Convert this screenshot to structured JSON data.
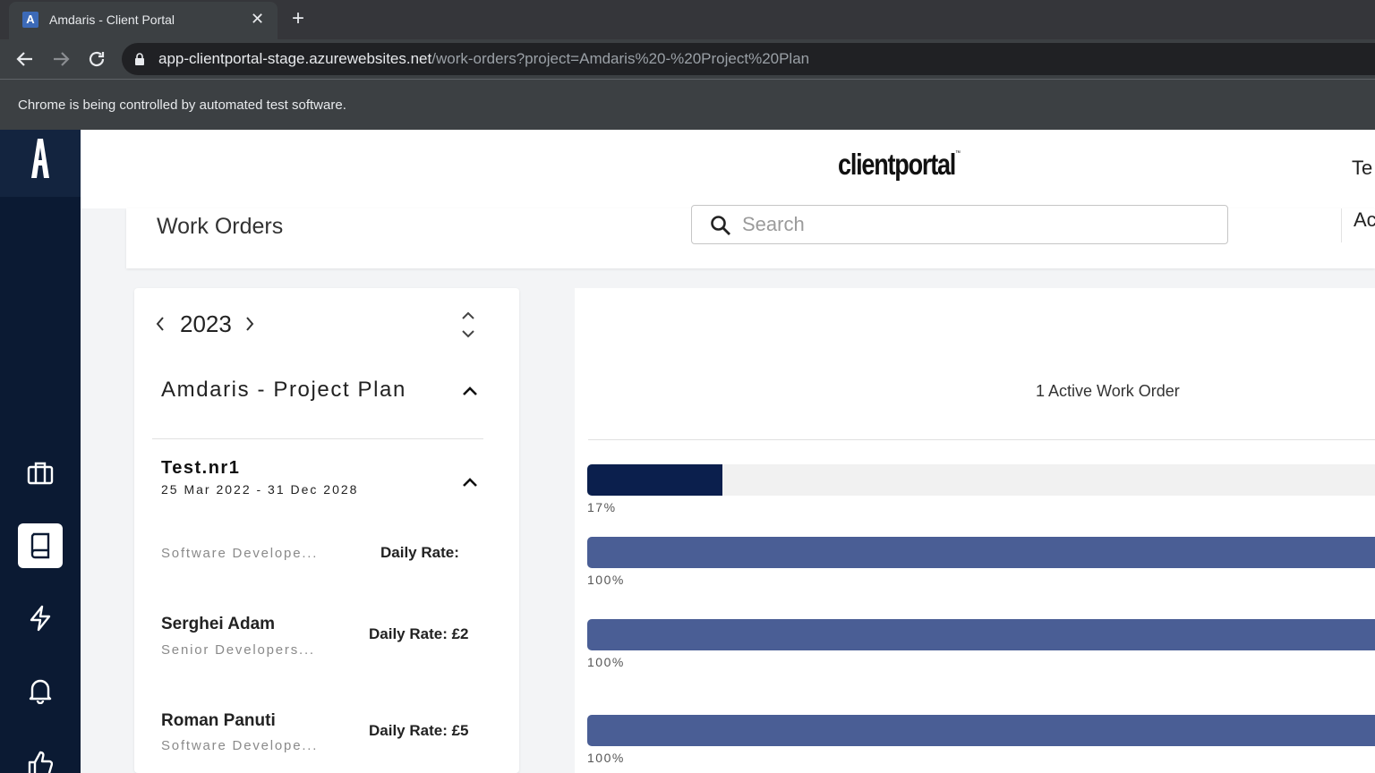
{
  "browser": {
    "tab_title": "Amdaris - Client Portal",
    "favicon_letter": "A",
    "url_host": "app-clientportal-stage.azurewebsites.net",
    "url_path": "/work-orders?project=Amdaris%20-%20Project%20Plan",
    "infobar_text": "Chrome is being controlled by automated test software."
  },
  "sidebar": {
    "items": [
      {
        "icon": "briefcase-icon",
        "active": false
      },
      {
        "icon": "book-icon",
        "active": true
      },
      {
        "icon": "lightning-icon",
        "active": false
      },
      {
        "icon": "bell-icon",
        "active": false
      },
      {
        "icon": "thumbs-up-icon",
        "active": false
      }
    ]
  },
  "header": {
    "brand": "clientportal",
    "brand_tm": "™",
    "user_text": "Te"
  },
  "page": {
    "title": "Work Orders",
    "search_placeholder": "Search",
    "right_text": "Ac"
  },
  "left_panel": {
    "year": "2023",
    "project_name": "Amdaris - Project Plan",
    "work_order": {
      "name": "Test.nr1",
      "dates": "25 Mar 2022 - 31 Dec 2028"
    },
    "members": [
      {
        "name": "",
        "role": "Software Develope...",
        "rate": "Daily Rate:"
      },
      {
        "name": "Serghei Adam",
        "role": "Senior Developers...",
        "rate": "Daily Rate: £2"
      },
      {
        "name": "Roman Panuti",
        "role": "Software Develope...",
        "rate": "Daily Rate: £5"
      }
    ]
  },
  "right_panel": {
    "active_count": "1 Active Work Order",
    "progress": [
      {
        "percent": 17,
        "label": "17%",
        "color": "#0b1f4d"
      },
      {
        "percent": 100,
        "label": "100%",
        "color": "#4a5e95"
      },
      {
        "percent": 100,
        "label": "100%",
        "color": "#4a5e95"
      },
      {
        "percent": 100,
        "label": "100%",
        "color": "#4a5e95"
      }
    ]
  }
}
